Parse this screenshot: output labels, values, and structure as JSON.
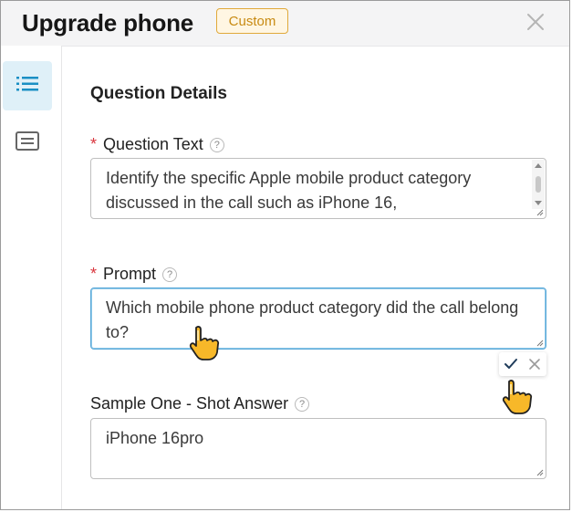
{
  "header": {
    "title": "Upgrade phone",
    "badge": "Custom",
    "close_icon": "close-icon"
  },
  "sidebar": {
    "items": [
      {
        "icon": "list-icon",
        "active": true
      },
      {
        "icon": "message-icon",
        "active": false
      }
    ]
  },
  "form": {
    "section_title": "Question Details",
    "question_text": {
      "label": "Question Text",
      "required_mark": "*",
      "help": "?",
      "value": "Identify the specific Apple mobile product category discussed in the call such as iPhone 16,"
    },
    "prompt": {
      "label": "Prompt",
      "required_mark": "*",
      "help": "?",
      "value": "Which mobile phone product category did the call belong to?"
    },
    "sample_answer": {
      "label": "Sample One - Shot Answer",
      "help": "?",
      "value": "iPhone 16pro"
    }
  },
  "colors": {
    "accent": "#1a8fc4",
    "required": "#d9363e",
    "badge_border": "#e0a93a",
    "badge_text": "#c88a12"
  }
}
